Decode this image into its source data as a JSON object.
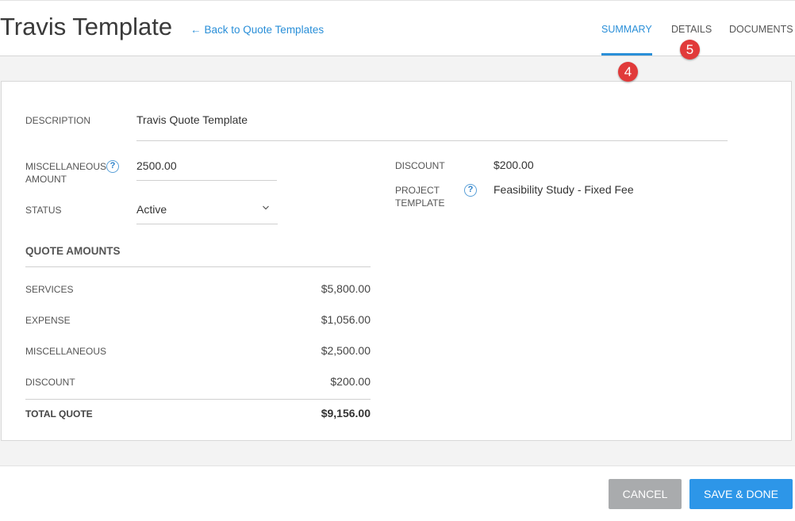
{
  "header": {
    "title": "Travis Template",
    "back_link": "Back to Quote Templates",
    "back_arrow": "←",
    "tabs": [
      {
        "label": "SUMMARY",
        "active": true
      },
      {
        "label": "DETAILS",
        "active": false
      },
      {
        "label": "DOCUMENTS",
        "active": false
      }
    ],
    "accent_color": "#2a8fd8"
  },
  "badges": [
    {
      "number": "4",
      "color": "#e13a3a"
    },
    {
      "number": "5",
      "color": "#e13a3a"
    }
  ],
  "form": {
    "description_label": "DESCRIPTION",
    "description_value": "Travis Quote Template",
    "misc_amount_label_1": "MISCELLANEOUS",
    "misc_amount_label_2": "AMOUNT",
    "misc_amount_value": "2500.00",
    "status_label": "STATUS",
    "status_value": "Active",
    "discount_label": "DISCOUNT",
    "discount_value": "$200.00",
    "project_template_label_1": "PROJECT",
    "project_template_label_2": "TEMPLATE",
    "project_template_value": "Feasibility Study - Fixed Fee",
    "help_glyph": "?"
  },
  "quote_amounts": {
    "title": "QUOTE AMOUNTS",
    "rows": [
      {
        "label": "SERVICES",
        "value": "$5,800.00"
      },
      {
        "label": "EXPENSE",
        "value": "$1,056.00"
      },
      {
        "label": "MISCELLANEOUS",
        "value": "$2,500.00"
      },
      {
        "label": "DISCOUNT",
        "value": "$200.00"
      }
    ],
    "total_label": "TOTAL QUOTE",
    "total_value": "$9,156.00"
  },
  "footer": {
    "cancel_label": "CANCEL",
    "save_label": "SAVE & DONE",
    "cancel_color": "#a9abad",
    "save_color": "#2d96e8"
  }
}
